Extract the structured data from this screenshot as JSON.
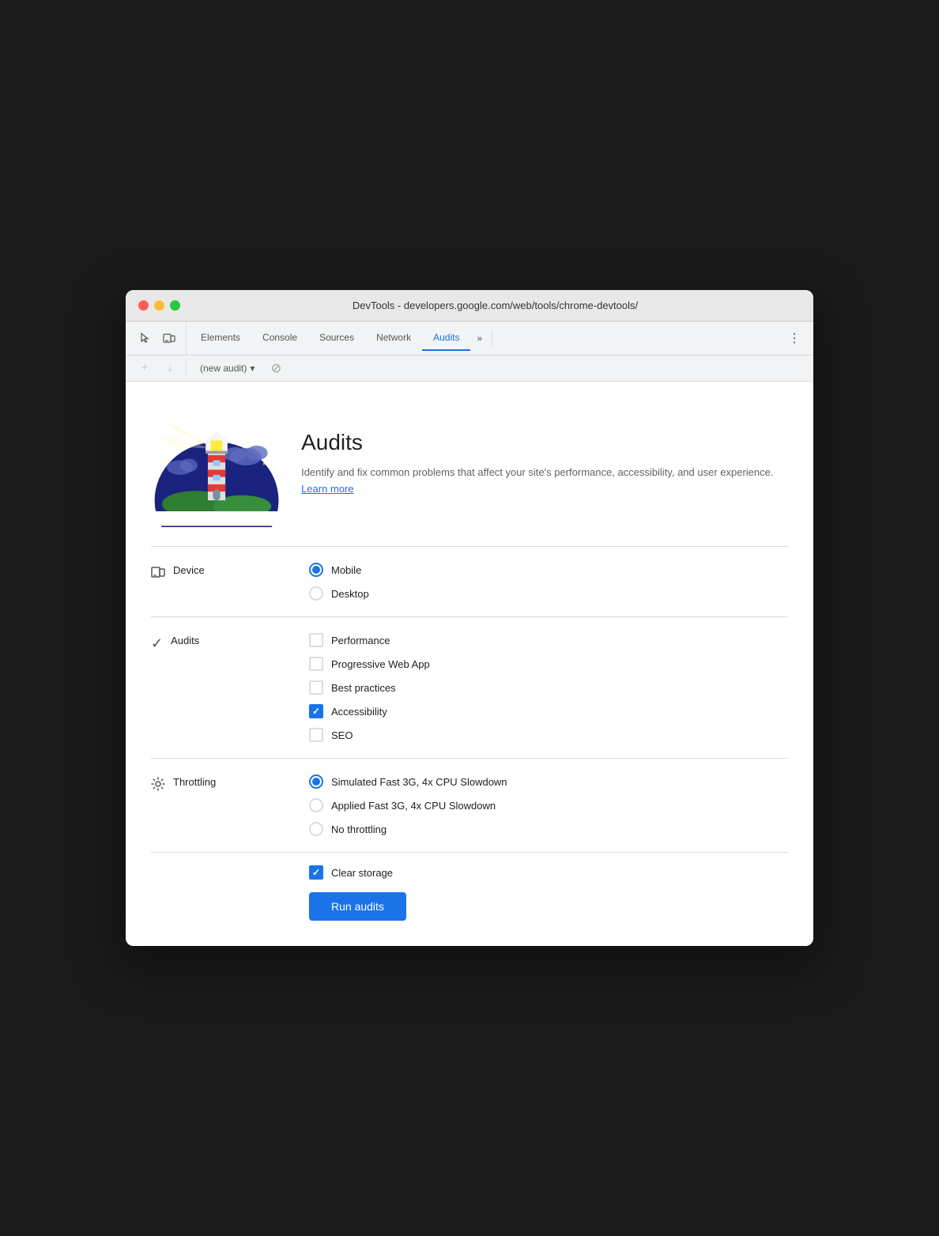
{
  "window": {
    "title": "DevTools - developers.google.com/web/tools/chrome-devtools/"
  },
  "tabs": {
    "items": [
      {
        "label": "Elements",
        "active": false
      },
      {
        "label": "Console",
        "active": false
      },
      {
        "label": "Sources",
        "active": false
      },
      {
        "label": "Network",
        "active": false
      },
      {
        "label": "Audits",
        "active": true
      }
    ],
    "more_label": "»",
    "menu_label": "⋮"
  },
  "toolbar": {
    "add_label": "+",
    "download_label": "↓",
    "select_label": "(new audit)",
    "block_label": "⊘"
  },
  "header": {
    "title": "Audits",
    "description": "Identify and fix common problems that affect your site's performance, accessibility, and user experience.",
    "learn_more": "Learn more"
  },
  "device": {
    "section_label": "Device",
    "options": [
      {
        "label": "Mobile",
        "selected": true
      },
      {
        "label": "Desktop",
        "selected": false
      }
    ]
  },
  "audits": {
    "section_label": "Audits",
    "options": [
      {
        "label": "Performance",
        "checked": false
      },
      {
        "label": "Progressive Web App",
        "checked": false
      },
      {
        "label": "Best practices",
        "checked": false
      },
      {
        "label": "Accessibility",
        "checked": true
      },
      {
        "label": "SEO",
        "checked": false
      }
    ]
  },
  "throttling": {
    "section_label": "Throttling",
    "options": [
      {
        "label": "Simulated Fast 3G, 4x CPU Slowdown",
        "selected": true
      },
      {
        "label": "Applied Fast 3G, 4x CPU Slowdown",
        "selected": false
      },
      {
        "label": "No throttling",
        "selected": false
      }
    ]
  },
  "clear_storage": {
    "label": "Clear storage",
    "checked": true
  },
  "run_button": {
    "label": "Run audits"
  }
}
